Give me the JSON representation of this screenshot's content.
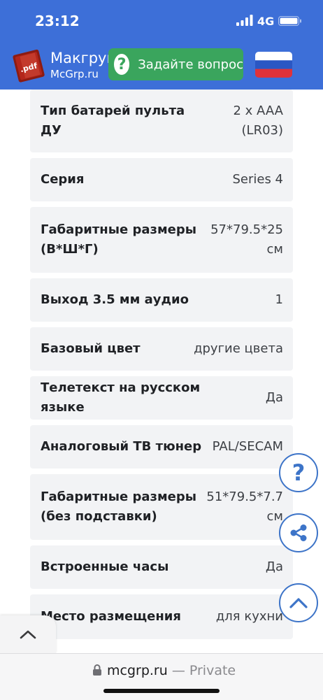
{
  "status_bar": {
    "time": "23:12",
    "network": "4G",
    "icons": [
      "signal-bars-icon",
      "battery-icon"
    ]
  },
  "header": {
    "brand_name": "Макгруп",
    "brand_domain": "McGrp.ru",
    "logo_badge": ".pdf",
    "ask_button_label": "Задайте вопрос",
    "ask_icon_glyph": "?",
    "flag": "russia-flag-icon",
    "colors": {
      "bar": "#3d6fd8",
      "button": "#3aa55d"
    }
  },
  "specs": [
    {
      "label": "Тип батарей пульта ДУ",
      "value": "2 x AAA (LR03)"
    },
    {
      "label": "Серия",
      "value": "Series 4"
    },
    {
      "label": "Габаритные размеры (В*Ш*Г)",
      "value": "57*79.5*25 см"
    },
    {
      "label": "Выход 3.5 мм аудио",
      "value": "1"
    },
    {
      "label": "Базовый цвет",
      "value": "другие цвета"
    },
    {
      "label": "Телетекст на русском языке",
      "value": "Да"
    },
    {
      "label": "Аналоговый ТВ тюнер",
      "value": "PAL/SECAM"
    },
    {
      "label": "Габаритные размеры (без подставки)",
      "value": "51*79.5*7.7 см"
    },
    {
      "label": "Встроенные часы",
      "value": "Да"
    },
    {
      "label": "Место размещения",
      "value": "для кухни"
    }
  ],
  "floating_buttons": {
    "help_glyph": "?",
    "icons": [
      "question-icon",
      "share-icon",
      "chevron-up-icon"
    ],
    "accent": "#3d74c8"
  },
  "browser": {
    "url": "mcgrp.ru",
    "separator": " — ",
    "mode": "Private"
  }
}
